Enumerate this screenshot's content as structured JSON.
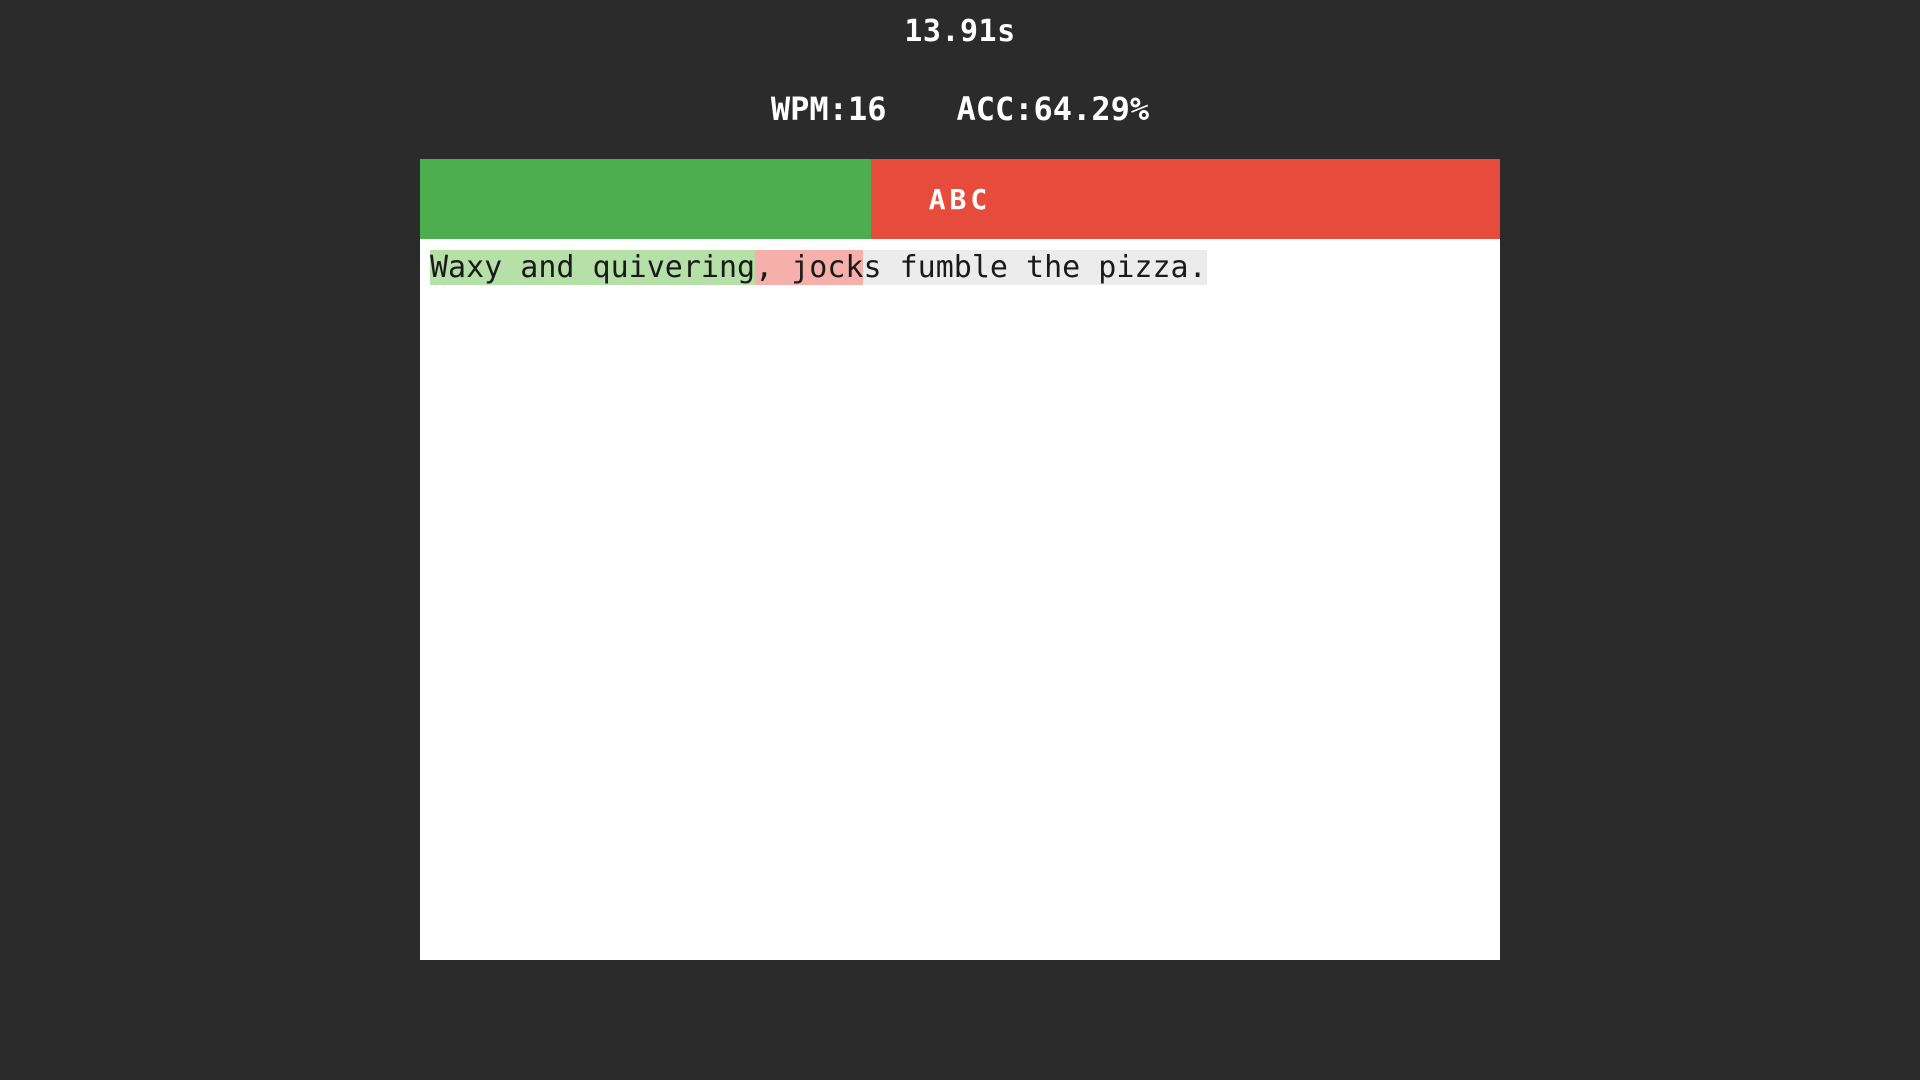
{
  "timer_text": "13.91s",
  "stats": {
    "wpm_label": "WPM:",
    "wpm_value": "16",
    "acc_label": "ACC:",
    "acc_value": "64.29%"
  },
  "progress": {
    "green_percent": 41.8,
    "bar_label": "ABC"
  },
  "typing": {
    "correct": "Waxy and quivering",
    "incorrect": ", jock",
    "pending": "s fumble the pizza."
  },
  "colors": {
    "bg": "#2b2b2b",
    "bar_green": "#4cae4f",
    "bar_red": "#e64b3c",
    "hl_correct": "#b5e0a7",
    "hl_incorrect": "#f6b0ab",
    "hl_pending": "#ececec"
  }
}
